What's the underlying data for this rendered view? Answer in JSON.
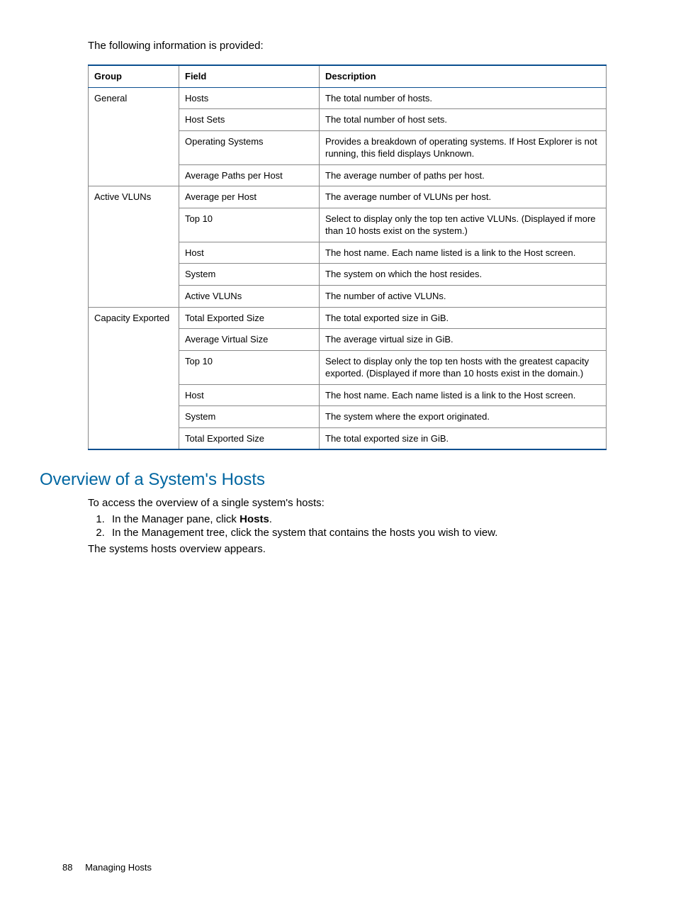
{
  "intro": "The following information is provided:",
  "table": {
    "headers": {
      "group": "Group",
      "field": "Field",
      "desc": "Description"
    },
    "rows": [
      {
        "group": "General",
        "groupspan": 4,
        "field": "Hosts",
        "desc": "The total number of hosts."
      },
      {
        "field": "Host Sets",
        "desc": "The total number of host sets."
      },
      {
        "field": "Operating Systems",
        "desc": "Provides a breakdown of operating systems. If Host Explorer is not running, this field displays Unknown."
      },
      {
        "field": "Average Paths per Host",
        "desc": "The average number of paths per host."
      },
      {
        "group": "Active VLUNs",
        "groupspan": 5,
        "field": "Average per Host",
        "desc": "The average number of VLUNs per host."
      },
      {
        "field": "Top 10",
        "desc": "Select to display only the top ten active VLUNs. (Displayed if more than 10 hosts exist on the system.)"
      },
      {
        "field": "Host",
        "desc": "The host name. Each name listed is a link to the Host screen."
      },
      {
        "field": "System",
        "desc": "The system on which the host resides."
      },
      {
        "field": "Active VLUNs",
        "desc": "The number of active VLUNs."
      },
      {
        "group": "Capacity Exported",
        "groupspan": 6,
        "field": "Total Exported Size",
        "desc": "The total exported size in GiB."
      },
      {
        "field": "Average Virtual Size",
        "desc": "The average virtual size in GiB."
      },
      {
        "field": "Top 10",
        "desc": "Select to display only the top ten hosts with the greatest capacity exported. (Displayed if more than 10 hosts exist in the domain.)"
      },
      {
        "field": "Host",
        "desc": "The host name. Each name listed is a link to the Host screen."
      },
      {
        "field": "System",
        "desc": "The system where the export originated."
      },
      {
        "field": "Total Exported Size",
        "desc": "The total exported size in GiB."
      }
    ]
  },
  "heading": "Overview of a System's Hosts",
  "access_intro": "To access the overview of a single system's hosts:",
  "steps": {
    "s1_pre": "In the Manager pane, click ",
    "s1_bold": "Hosts",
    "s1_post": ".",
    "s2": "In the Management tree, click the system that contains the hosts you wish to view."
  },
  "after_steps": "The systems hosts overview appears.",
  "footer": {
    "page": "88",
    "section": "Managing Hosts"
  }
}
